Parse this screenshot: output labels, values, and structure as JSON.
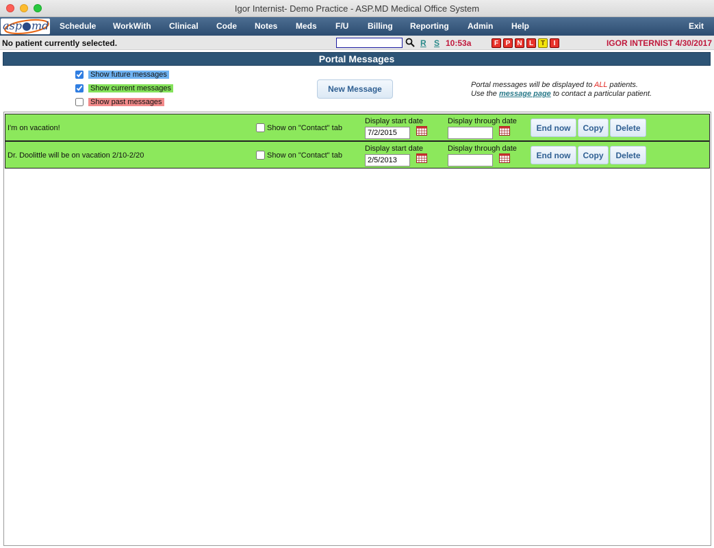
{
  "window": {
    "title": "Igor Internist- Demo Practice - ASP.MD Medical Office System"
  },
  "logo": {
    "text": "asp●md"
  },
  "menu": {
    "items": [
      {
        "label": "Schedule"
      },
      {
        "label": "WorkWith"
      },
      {
        "label": "Clinical"
      },
      {
        "label": "Code"
      },
      {
        "label": "Notes"
      },
      {
        "label": "Meds"
      },
      {
        "label": "F/U"
      },
      {
        "label": "Billing"
      },
      {
        "label": "Reporting"
      },
      {
        "label": "Admin"
      },
      {
        "label": "Help"
      }
    ],
    "exit_label": "Exit"
  },
  "status": {
    "no_patient": "No patient currently selected.",
    "search_value": "",
    "link_r": "R",
    "link_s": "S",
    "time": "10:53a",
    "flags": [
      {
        "label": "F",
        "color": "#e8322a"
      },
      {
        "label": "P",
        "color": "#e8322a"
      },
      {
        "label": "N",
        "color": "#e8322a"
      },
      {
        "label": "L",
        "color": "#e8322a"
      },
      {
        "label": "T",
        "color": "#f3e40c"
      },
      {
        "label": "I",
        "color": "#e8322a"
      }
    ],
    "user_date": "IGOR INTERNIST 4/30/2017"
  },
  "section": {
    "title": "Portal Messages"
  },
  "filters": {
    "future": {
      "label": "Show future messages",
      "checked": true,
      "color": "#6fb3f2"
    },
    "current": {
      "label": "Show current messages",
      "checked": true,
      "color": "#84e25a"
    },
    "past": {
      "label": "Show past messages",
      "checked": false,
      "color": "#f28a8a"
    }
  },
  "new_message_label": "New Message",
  "info": {
    "line1_prefix": "Portal messages will be displayed to ",
    "line1_all": "ALL",
    "line1_suffix": " patients.",
    "line2_prefix": "Use the ",
    "line2_link": "message page",
    "line2_suffix": " to contact a particular patient."
  },
  "messages": [
    {
      "text": "I'm on vacation!",
      "contact_label": "Show on \"Contact\" tab",
      "contact_checked": false,
      "start_label": "Display start date",
      "start_date": "7/2/2015",
      "through_label": "Display through date",
      "through_date": "",
      "end_now_label": "End now",
      "copy_label": "Copy",
      "delete_label": "Delete"
    },
    {
      "text": "Dr. Doolittle will be on vacation 2/10-2/20",
      "contact_label": "Show on \"Contact\" tab",
      "contact_checked": false,
      "start_label": "Display start date",
      "start_date": "2/5/2013",
      "through_label": "Display through date",
      "through_date": "",
      "end_now_label": "End now",
      "copy_label": "Copy",
      "delete_label": "Delete"
    }
  ],
  "colors": {
    "menu_bg": "#2c4c70",
    "header_bg": "#2d5476",
    "row_bg": "#8ce85c",
    "accent_red": "#c0183c"
  }
}
